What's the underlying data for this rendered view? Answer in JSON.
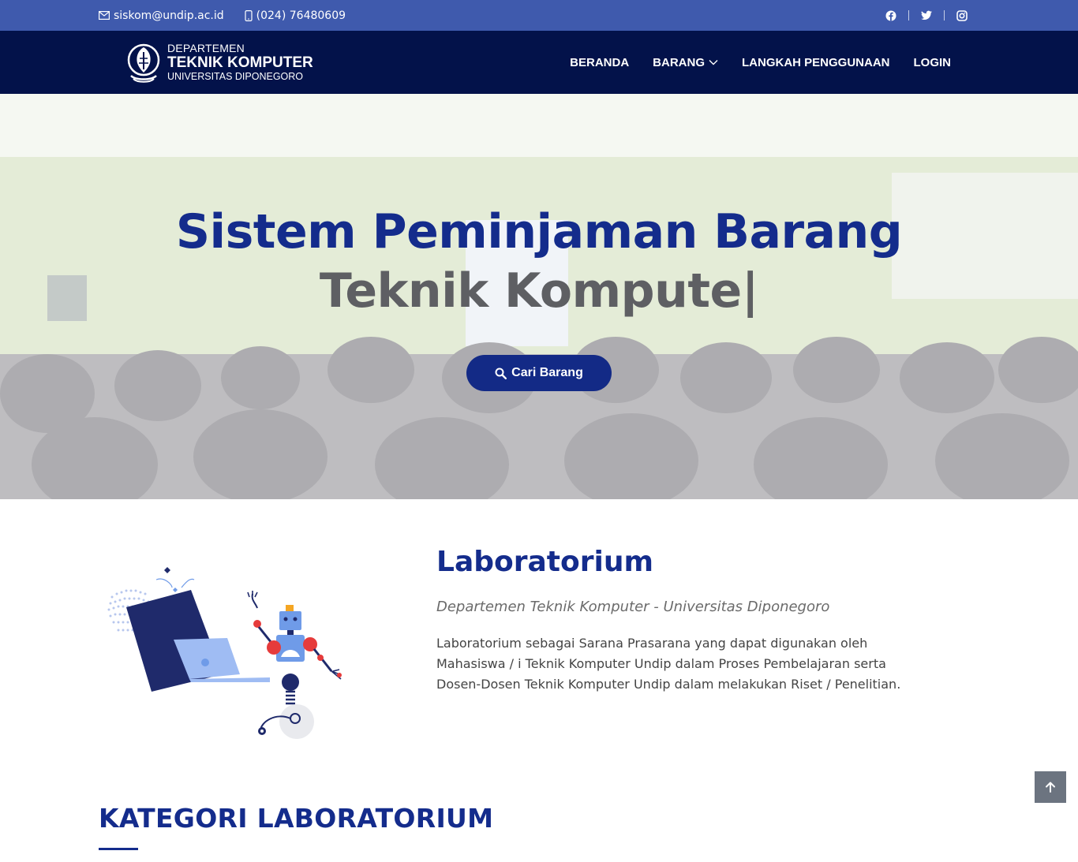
{
  "topbar": {
    "email": "siskom@undip.ac.id",
    "phone": "(024) 76480609",
    "social": [
      "facebook-icon",
      "twitter-icon",
      "instagram-icon"
    ]
  },
  "brand": {
    "line1": "DEPARTEMEN",
    "line2": "TEKNIK KOMPUTER",
    "line3": "UNIVERSITAS DIPONEGORO"
  },
  "nav": {
    "items": [
      {
        "label": "BERANDA"
      },
      {
        "label": "BARANG"
      },
      {
        "label": "LANGKAH PENGGUNAAN"
      },
      {
        "label": "LOGIN"
      }
    ]
  },
  "hero": {
    "title": "Sistem Peminjaman Barang",
    "typed": "Teknik Kompute|",
    "cta_label": "Cari Barang"
  },
  "about": {
    "title": "Laboratorium",
    "subtitle": "Departemen Teknik Komputer - Universitas Diponegoro",
    "description": "Laboratorium sebagai Sarana Prasarana yang dapat digunakan oleh Mahasiswa / i Teknik Komputer Undip dalam Proses Pembelajaran serta Dosen-Dosen Teknik Komputer Undip dalam melakukan Riset / Penelitian."
  },
  "category": {
    "title": "KATEGORI LABORATORIUM"
  },
  "colors": {
    "topbar": "#3f5aad",
    "navbar": "#03124a",
    "accent": "#142c8c",
    "heading_gray": "#5e5f63"
  }
}
